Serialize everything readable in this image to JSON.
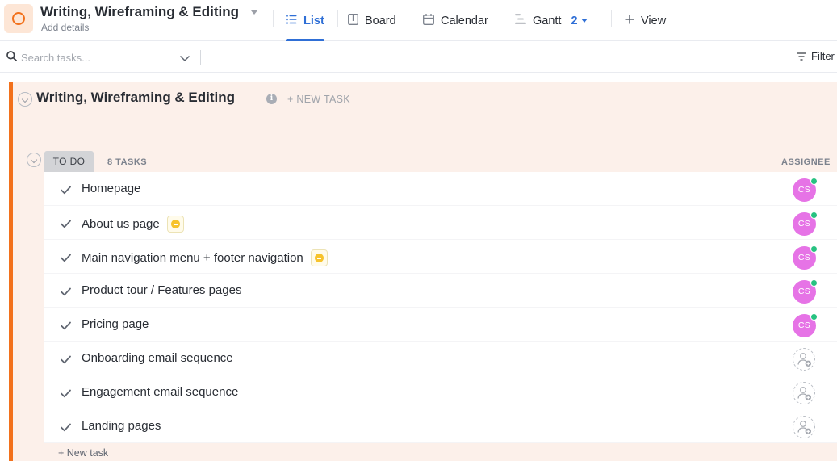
{
  "header": {
    "title": "Writing, Wireframing & Editing",
    "subtitle": "Add details"
  },
  "views": [
    {
      "label": "List",
      "icon": "list-icon",
      "active": true
    },
    {
      "label": "Board",
      "icon": "board-icon",
      "active": false
    },
    {
      "label": "Calendar",
      "icon": "calendar-icon",
      "active": false
    },
    {
      "label": "Gantt",
      "icon": "gantt-icon",
      "active": false,
      "badge": "2"
    },
    {
      "label": "View",
      "icon": "plus-icon",
      "active": false
    }
  ],
  "search": {
    "placeholder": "Search tasks...",
    "value": ""
  },
  "filter_label": "Filter",
  "list": {
    "title": "Writing, Wireframing & Editing",
    "new_task_label": "+ NEW TASK",
    "accent_color": "#f2711c",
    "panel_color": "#fcf0ea"
  },
  "group": {
    "status": "TO DO",
    "task_count": "8 TASKS",
    "assignee_header": "ASSIGNEE"
  },
  "tasks": [
    {
      "name": "Homepage",
      "priority": false,
      "assignee": "CS"
    },
    {
      "name": "About us page",
      "priority": true,
      "assignee": "CS"
    },
    {
      "name": "Main navigation menu + footer navigation",
      "priority": true,
      "assignee": "CS"
    },
    {
      "name": "Product tour / Features pages",
      "priority": false,
      "assignee": "CS"
    },
    {
      "name": "Pricing page",
      "priority": false,
      "assignee": "CS"
    },
    {
      "name": "Onboarding email sequence",
      "priority": false,
      "assignee": ""
    },
    {
      "name": "Engagement email sequence",
      "priority": false,
      "assignee": ""
    },
    {
      "name": "Landing pages",
      "priority": false,
      "assignee": ""
    }
  ],
  "footer": {
    "new_task_label": "+ New task"
  },
  "colors": {
    "primary": "#2f6fd6",
    "avatar": "#e673e6",
    "online": "#27c281",
    "priority": "#f7c32c"
  }
}
